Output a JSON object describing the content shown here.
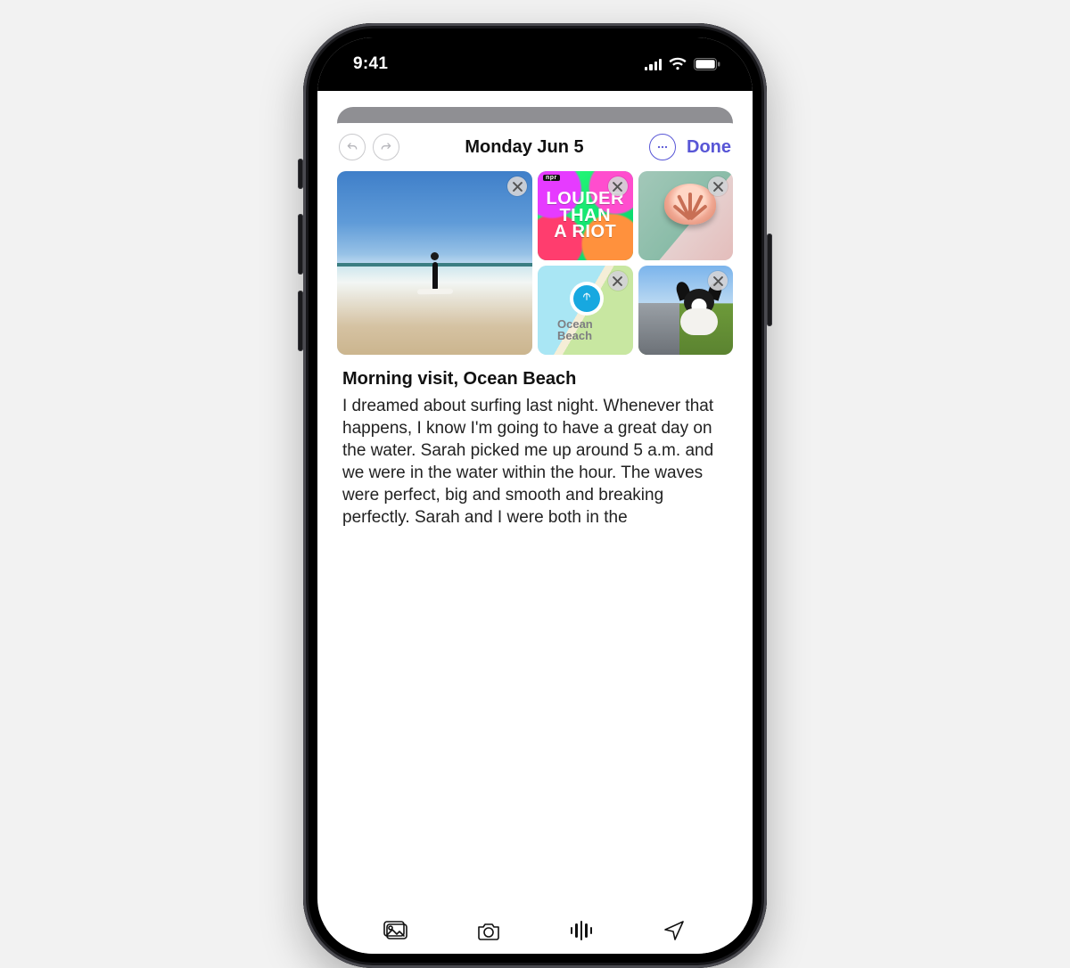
{
  "status_bar": {
    "time": "9:41"
  },
  "header": {
    "date": "Monday Jun 5",
    "done": "Done"
  },
  "attachments": {
    "riot_line1": "LOUDER",
    "riot_line2": "THAN",
    "riot_line3": "A RIOT",
    "riot_publisher": "npr",
    "map_label_line1": "Ocean",
    "map_label_line2": "Beach"
  },
  "entry": {
    "title": "Morning visit, Ocean Beach",
    "body": "I dreamed about surfing last night. Whenever that happens, I know I'm going to have a great day on the water. Sarah picked me up around 5 a.m. and we were in the water within the hour. The waves were perfect, big and smooth and breaking perfectly. Sarah and I were both in the"
  },
  "colors": {
    "accent": "#5856d6"
  }
}
